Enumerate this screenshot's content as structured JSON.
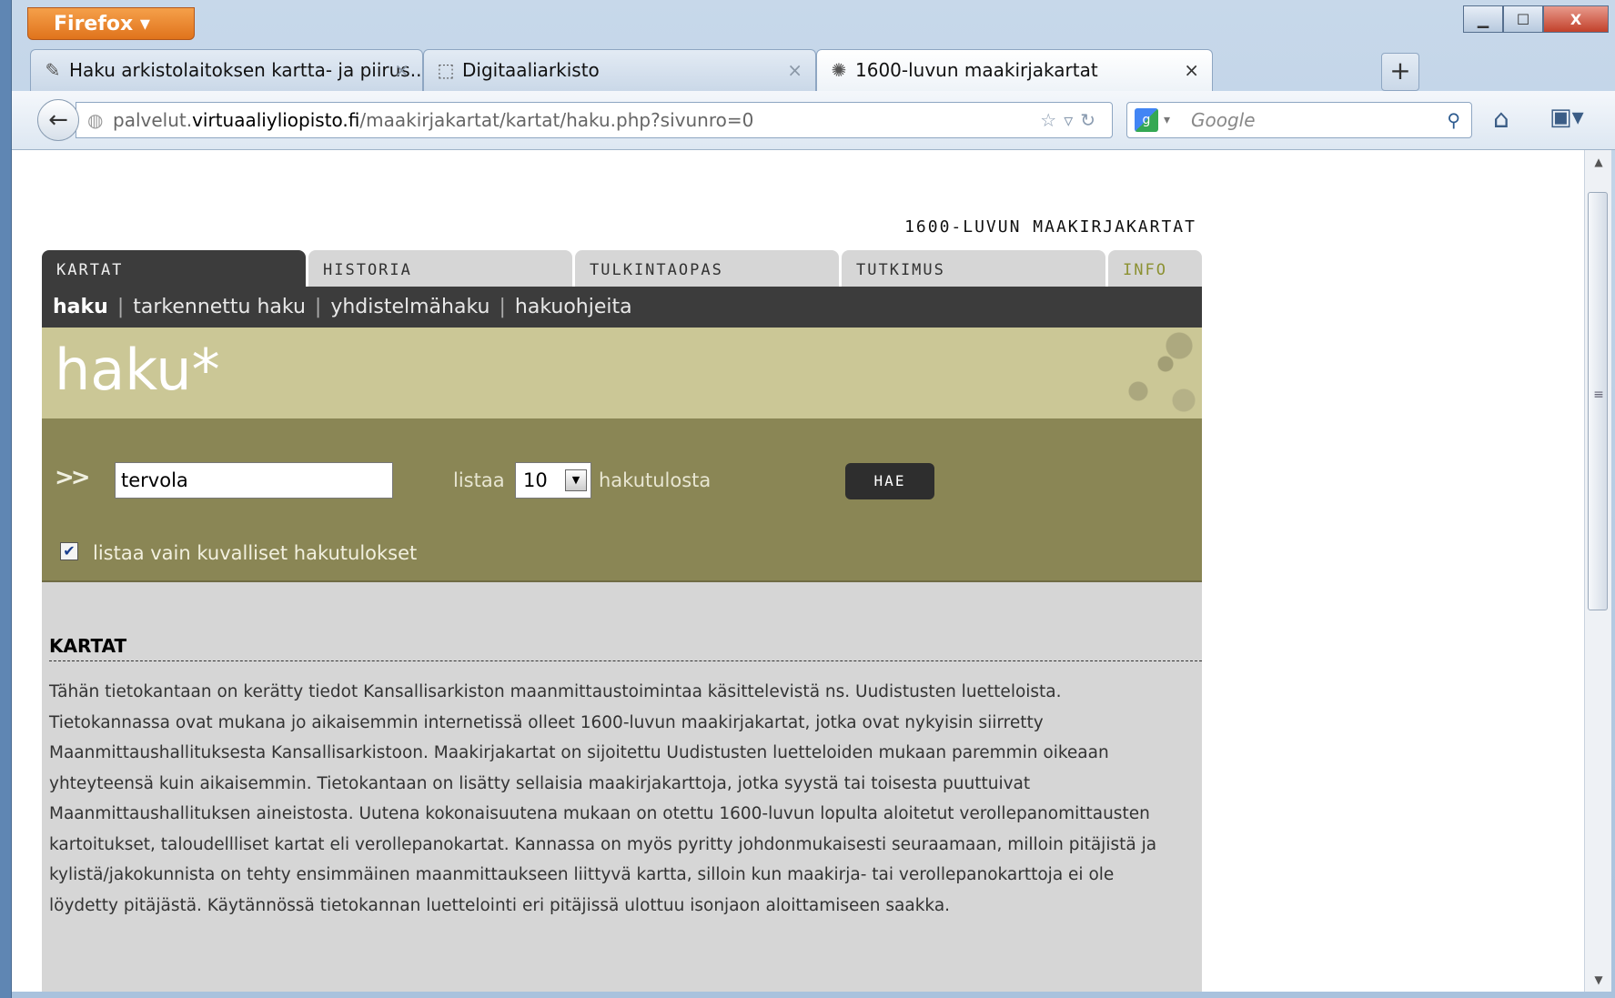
{
  "browser": {
    "app_button_label": "Firefox ▾",
    "tabs": [
      {
        "label": "Haku arkistolaitoksen kartta- ja piirus...",
        "icon": "✎"
      },
      {
        "label": "Digitaaliarkisto",
        "icon": "⬚"
      },
      {
        "label": "1600-luvun maakirjakartat",
        "icon": "✺"
      }
    ],
    "tab_close": "×",
    "new_tab": "+",
    "url_host_prefix": "palvelut.",
    "url_host": "virtuaaliyliopisto.fi",
    "url_path": "/maakirjakartat/kartat/haku.php?sivunro=0",
    "search_placeholder": "Google",
    "window_controls": {
      "minimize": "▁",
      "maximize": "☐",
      "close": "X"
    }
  },
  "site": {
    "title": "1600-LUVUN MAAKIRJAKARTAT",
    "main_tabs": [
      "KARTAT",
      "HISTORIA",
      "TULKINTAOPAS",
      "TUTKIMUS",
      "INFO"
    ],
    "subnav": [
      "haku",
      "tarkennettu haku",
      "yhdistelmähaku",
      "hakuohjeita"
    ],
    "banner_title": "haku*"
  },
  "search": {
    "arrows": ">>",
    "query": "tervola",
    "list_label": "listaa",
    "list_count": "10",
    "results_label": "hakutulosta",
    "submit_label": "HAE",
    "only_images_checked": true,
    "only_images_label": "listaa vain kuvalliset hakutulokset"
  },
  "article": {
    "heading": "KARTAT",
    "text": "Tähän tietokantaan on kerätty tiedot Kansallisarkiston maanmittaustoimintaa käsittelevistä ns. Uudistusten luetteloista. Tietokannassa ovat mukana jo aikaisemmin internetissä olleet 1600-luvun maakirjakartat, jotka ovat nykyisin siirretty Maanmittaushallituksesta Kansallisarkistoon. Maakirjakartat on sijoitettu Uudistusten luetteloiden mukaan paremmin oikeaan yhteyteensä kuin aikaisemmin. Tietokantaan on lisätty sellaisia maakirjakarttoja, jotka syystä tai toisesta puuttuivat Maanmittaushallituksen aineistosta. Uutena kokonaisuutena mukaan on otettu 1600-luvun lopulta aloitetut verollepanomittausten kartoitukset, taloudellliset kartat eli verollepanokartat. Kannassa on myös pyritty johdonmukaisesti seuraamaan, milloin pitäjistä ja kylistä/jakokunnista on tehty ensimmäinen maanmittaukseen liittyvä kartta, silloin kun maakirja- tai verollepanokarttoja ei ole löydetty pitäjästä. Käytännössä tietokannan luettelointi eri pitäjissä ulottuu isonjaon aloittamiseen saakka."
  }
}
